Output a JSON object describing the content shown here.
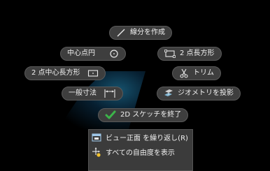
{
  "marking_menu": {
    "line": {
      "label": "線分を作成",
      "icon": "line-icon"
    },
    "center_circle": {
      "label": "中心点円",
      "icon": "center-circle-icon"
    },
    "two_point_rect": {
      "label": "2 点長方形",
      "icon": "two-point-rectangle-icon"
    },
    "two_point_center_rect": {
      "label": "2 点中心長方形",
      "icon": "center-rectangle-icon"
    },
    "trim": {
      "label": "トリム",
      "icon": "scissors-icon"
    },
    "dimension": {
      "label": "一般寸法",
      "icon": "dimension-icon"
    },
    "project_geometry": {
      "label": "ジオメトリを投影",
      "icon": "project-geometry-icon"
    },
    "finish_sketch": {
      "label": "2D スケッチを終了",
      "icon": "checkmark-icon"
    }
  },
  "context_menu": {
    "items": [
      {
        "label": "ビュー正面 を繰り返し(R)",
        "icon": "view-face-icon"
      },
      {
        "label": "すべての自由度を表示",
        "icon": "degrees-of-freedom-icon"
      }
    ]
  },
  "colors": {
    "pill_bg": "#3e3e3e",
    "accent_green": "#3cb44a",
    "glow": "#2896c8"
  }
}
